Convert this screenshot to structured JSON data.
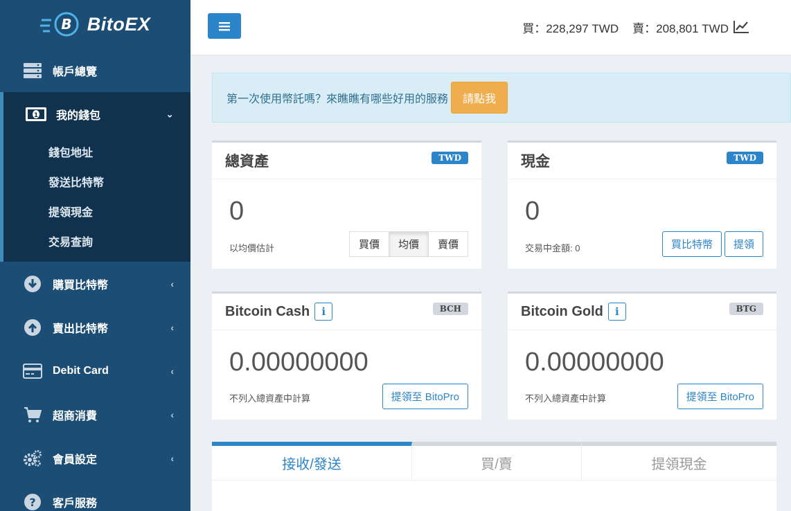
{
  "brand": {
    "name": "BitoEX"
  },
  "sidebar": {
    "items": [
      {
        "label": "帳戶總覽",
        "icon": "server-icon"
      },
      {
        "label": "我的錢包",
        "icon": "money-icon"
      },
      {
        "label": "購買比特幣",
        "icon": "arrow-circle-down-icon"
      },
      {
        "label": "賣出比特幣",
        "icon": "arrow-circle-up-icon"
      },
      {
        "label": "Debit Card",
        "icon": "credit-card-icon"
      },
      {
        "label": "超商消費",
        "icon": "cart-icon"
      },
      {
        "label": "會員設定",
        "icon": "gears-icon"
      },
      {
        "label": "客戶服務",
        "icon": "question-circle-icon"
      }
    ],
    "wallet_submenu": [
      "錢包地址",
      "發送比特幣",
      "提領現金",
      "交易查詢"
    ]
  },
  "topbar": {
    "buy_price": "買：228,297 TWD",
    "sell_price": "賣：208,801 TWD"
  },
  "callout": {
    "text": "第一次使用幣託嗎？來瞧瞧有哪些好用的服務",
    "button": "請點我"
  },
  "total_assets": {
    "title": "總資產",
    "badge": "TWD",
    "value": "0",
    "note": "以均價估計",
    "toggle": [
      "買價",
      "均價",
      "賣價"
    ],
    "active_toggle": "均價"
  },
  "cash": {
    "title": "現金",
    "badge": "TWD",
    "value": "0",
    "note": "交易中金額: 0",
    "buttons": [
      "買比特幣",
      "提領"
    ]
  },
  "bch": {
    "title": "Bitcoin Cash",
    "badge": "BCH",
    "value": "0.00000000",
    "note": "不列入總資產中計算",
    "button": "提領至 BitoPro"
  },
  "btg": {
    "title": "Bitcoin Gold",
    "badge": "BTG",
    "value": "0.00000000",
    "note": "不列入總資產中計算",
    "button": "提領至 BitoPro"
  },
  "tabs": [
    "接收/發送",
    "買/賣",
    "提領現金"
  ],
  "colors": {
    "sidebar": "#1c4e75",
    "sidebar_active": "#10324f",
    "primary": "#2c84c9",
    "warning": "#f0ad4e",
    "callout_bg": "#d9edf7"
  }
}
